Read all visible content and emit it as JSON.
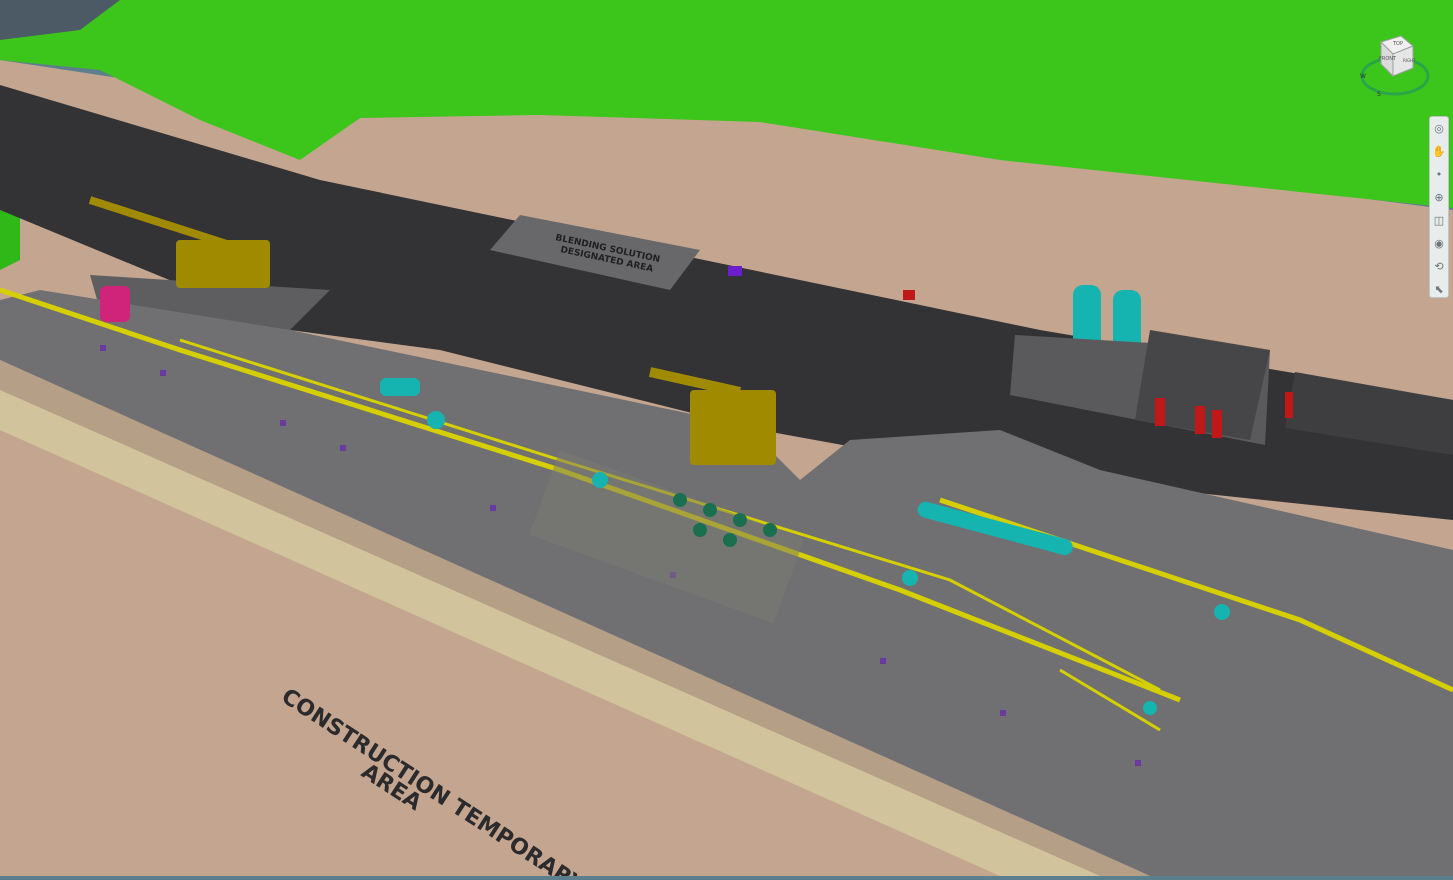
{
  "scene": {
    "labels": {
      "construction_area_line1": "CONSTRUCTION TEMPORARY",
      "construction_area_line2": "AREA",
      "designated_area_line1": "BLENDING SOLUTION",
      "designated_area_line2": "DESIGNATED AREA"
    }
  },
  "viewcube": {
    "top": "TOP",
    "front": "FRONT",
    "right": "RIGHT",
    "compass_w": "W",
    "compass_s": "S"
  },
  "navbar": {
    "tools": [
      {
        "icon": "steering-wheel-icon",
        "glyph": "◎"
      },
      {
        "icon": "pan-icon",
        "glyph": "✋"
      },
      {
        "icon": "orbit-icon",
        "glyph": "•"
      },
      {
        "icon": "zoom-icon",
        "glyph": "⊕"
      },
      {
        "icon": "zoom-window-icon",
        "glyph": "◫"
      },
      {
        "icon": "look-icon",
        "glyph": "◉"
      },
      {
        "icon": "walk-icon",
        "glyph": "⟲"
      },
      {
        "icon": "select-icon",
        "glyph": "⬉"
      }
    ]
  },
  "colors": {
    "water": "#5b7f8c",
    "terrain_green": "#3cc51a",
    "ground_tan": "#c4a590",
    "road": "#333335",
    "platform": "#707072",
    "pipe_yellow": "#d6cf00",
    "equipment_cyan": "#16b4b0",
    "crane_olive": "#a08a00",
    "magenta_tank": "#d0237a"
  }
}
